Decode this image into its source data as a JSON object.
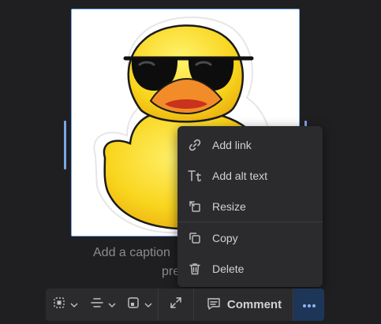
{
  "image": {
    "alt": "rubber duck sticker with sunglasses"
  },
  "caption": {
    "line1": "Add a caption",
    "line2": "pre"
  },
  "menu": {
    "items": [
      {
        "label": "Add link",
        "icon": "link-icon"
      },
      {
        "label": "Add alt text",
        "icon": "alt-text-icon"
      },
      {
        "label": "Resize",
        "icon": "resize-icon"
      },
      {
        "label": "Copy",
        "icon": "copy-icon"
      },
      {
        "label": "Delete",
        "icon": "trash-icon"
      }
    ]
  },
  "toolbar": {
    "comment_label": "Comment",
    "buttons": [
      "align-icon",
      "spacing-icon",
      "frame-icon",
      "expand-icon",
      "more-icon"
    ]
  },
  "colors": {
    "background": "#1f1f21",
    "panel": "#2b2b2e",
    "selection": "#7ba7e6",
    "more_button": "#1d3557",
    "duck_yellow": "#f7d21c",
    "beak_orange": "#f28c28"
  }
}
